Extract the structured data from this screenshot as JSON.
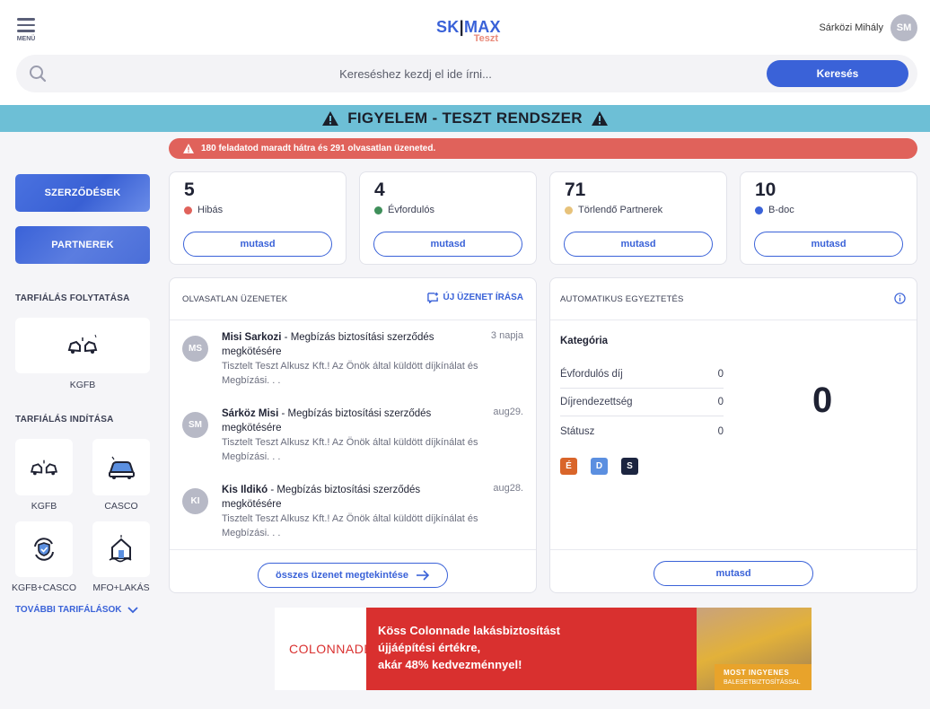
{
  "header": {
    "menu_label": "MENÜ",
    "logo_left": "SK",
    "logo_pipe": "|",
    "logo_right": "MAX",
    "logo_sub": "Teszt",
    "user_name": "Sárközi Mihály",
    "user_initials": "SM"
  },
  "search": {
    "placeholder": "Kereséshez kezdj el ide írni...",
    "button": "Keresés"
  },
  "warning_banner": "FIGYELEM - TESZT RENDSZER",
  "alert": "180 feladatod maradt hátra és 291 olvasatlan üzeneted.",
  "sidebar": {
    "contracts": "SZERZŐDÉSEK",
    "partners": "PARTNEREK",
    "continue_title": "TARFIÁLÁS FOLYTATÁSA",
    "continue_item": "KGFB",
    "start_title": "TARFIÁLÁS INDÍTÁSA",
    "start_items": [
      "KGFB",
      "CASCO",
      "KGFB+CASCO",
      "MFO+LAKÁS"
    ],
    "more": "TOVÁBBI TARIFÁLÁSOK"
  },
  "stats": [
    {
      "value": "5",
      "label": "Hibás",
      "color": "#e0625b",
      "button": "mutasd"
    },
    {
      "value": "4",
      "label": "Évfordulós",
      "color": "#3f8f5a",
      "button": "mutasd"
    },
    {
      "value": "71",
      "label": "Törlendő Partnerek",
      "color": "#e7c27a",
      "button": "mutasd"
    },
    {
      "value": "10",
      "label": "B-doc",
      "color": "#3a62d8",
      "button": "mutasd"
    }
  ],
  "messages_panel": {
    "title": "OLVASATLAN ÜZENETEK",
    "new_message": "ÚJ ÜZENET ÍRÁSA",
    "items": [
      {
        "initials": "MS",
        "sender": "Misi Sarkozi",
        "subject": " - Megbízás biztosítási szerződés megkötésére",
        "time": "3 napja",
        "body": "Tisztelt Teszt Alkusz Kft.! Az Önök által küldött díjkínálat és Megbízási. . ."
      },
      {
        "initials": "SM",
        "sender": "Sárköz Misi",
        "subject": " - Megbízás biztosítási szerződés megkötésére",
        "time": "aug29.",
        "body": "Tisztelt Teszt Alkusz Kft.! Az Önök által küldött díjkínálat és Megbízási. . ."
      },
      {
        "initials": "KI",
        "sender": "Kis Ildikó",
        "subject": " - Megbízás biztosítási szerződés megkötésére",
        "time": "aug28.",
        "body": "Tisztelt Teszt Alkusz Kft.! Az Önök által küldött díjkínálat és Megbízási. . ."
      }
    ],
    "view_all": "összes üzenet megtekintése"
  },
  "auto_panel": {
    "title": "AUTOMATIKUS EGYEZTETÉS",
    "category_title": "Kategória",
    "rows": [
      {
        "label": "Évfordulós díj",
        "value": "0"
      },
      {
        "label": "Díjrendezettség",
        "value": "0"
      },
      {
        "label": "Státusz",
        "value": "0"
      }
    ],
    "total": "0",
    "chips": [
      {
        "letter": "É",
        "color": "#d9652a"
      },
      {
        "letter": "D",
        "color": "#5b8fe0"
      },
      {
        "letter": "S",
        "color": "#1c2540"
      }
    ],
    "button": "mutasd"
  },
  "ad": {
    "logo": "COLONNADE",
    "line1": "Köss Colonnade lakásbiztosítást",
    "line2": "újjáépítési értékre,",
    "line3": "akár 48% kedvezménnyel!",
    "tag_line1": "MOST INGYENES",
    "tag_line2": "BALESETBIZTOSÍTÁSSAL"
  }
}
